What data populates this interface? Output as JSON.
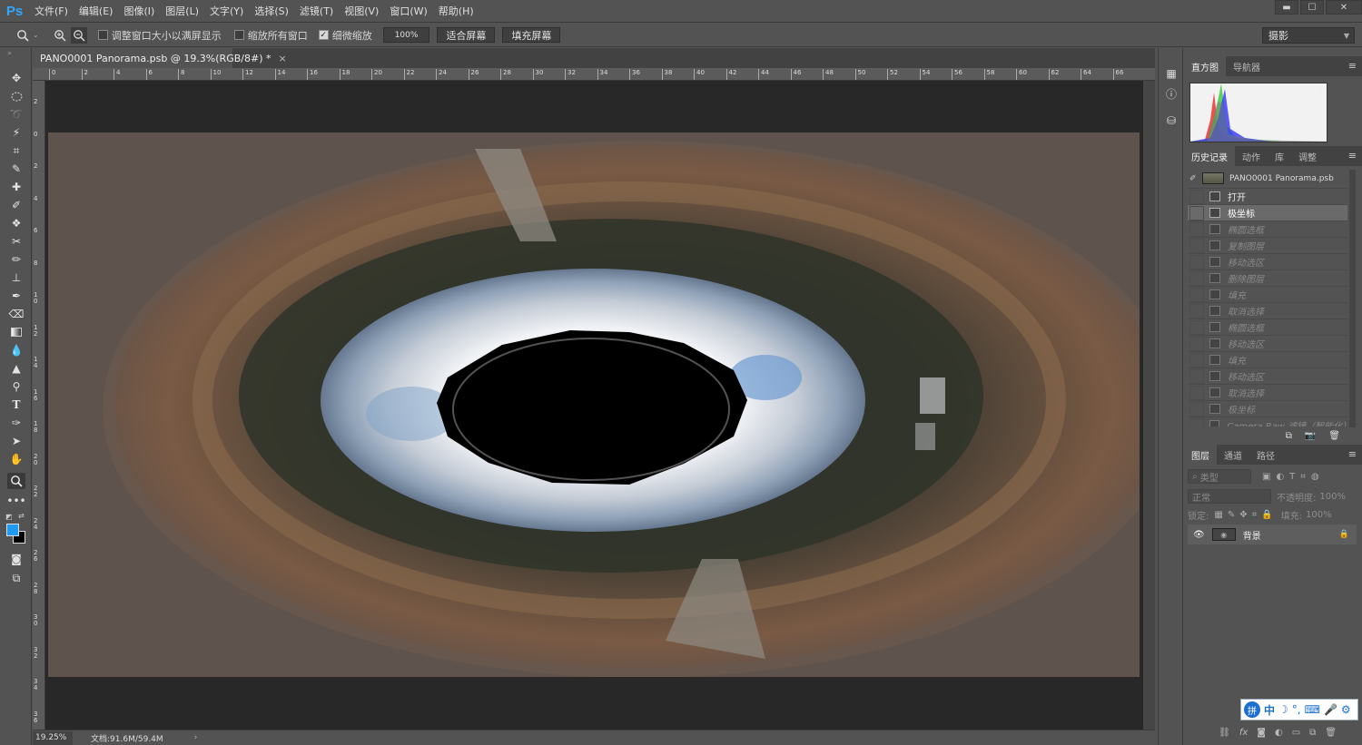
{
  "app": {
    "logo": "Ps"
  },
  "menu": [
    "文件(F)",
    "编辑(E)",
    "图像(I)",
    "图层(L)",
    "文字(Y)",
    "选择(S)",
    "滤镜(T)",
    "视图(V)",
    "窗口(W)",
    "帮助(H)"
  ],
  "window_controls": {
    "minimize": "▬",
    "maximize": "☐",
    "close": "✕"
  },
  "options": {
    "zoom_tool_icon": "zoom-icon",
    "resize_windows_label": "调整窗口大小以满屏显示",
    "resize_windows_checked": false,
    "zoom_all_label": "缩放所有窗口",
    "zoom_all_checked": false,
    "scrubby_label": "细微缩放",
    "scrubby_checked": true,
    "btn_100": "100%",
    "btn_fit": "适合屏幕",
    "btn_fill": "填充屏幕",
    "workspace": "摄影"
  },
  "document": {
    "tab_title": "PANO0001 Panorama.psb @ 19.3%(RGB/8#) *",
    "tab_close": "×",
    "ruler_h_labels": [
      "0",
      "2",
      "4",
      "6",
      "8",
      "10",
      "12",
      "14",
      "16",
      "18",
      "20",
      "22",
      "24",
      "26",
      "28",
      "30",
      "32",
      "34",
      "36",
      "38",
      "40",
      "42",
      "44",
      "46",
      "48",
      "50",
      "52",
      "54",
      "56",
      "58",
      "60",
      "62",
      "64",
      "66"
    ],
    "ruler_v_labels": [
      "2",
      "0",
      "2",
      "4",
      "6",
      "8",
      "1 0",
      "1 2",
      "1 4",
      "1 6",
      "1 8",
      "2 0",
      "2 2",
      "2 4",
      "2 6",
      "2 8",
      "3 0",
      "3 2",
      "3 4",
      "3 6"
    ]
  },
  "status": {
    "zoom": "19.25%",
    "doc_info": "文档:91.6M/59.4M",
    "arrow": "›"
  },
  "panels": {
    "histogram_tabs": [
      "直方图",
      "导航器"
    ],
    "history_tabs": [
      "历史记录",
      "动作",
      "库",
      "调整"
    ],
    "history_snapshot": "PANO0001 Panorama.psb",
    "history_items": [
      {
        "label": "打开",
        "state": "normal"
      },
      {
        "label": "极坐标",
        "state": "selected"
      },
      {
        "label": "椭圆选框",
        "state": "dim"
      },
      {
        "label": "复制图层",
        "state": "dim"
      },
      {
        "label": "移动选区",
        "state": "dim"
      },
      {
        "label": "删除图层",
        "state": "dim"
      },
      {
        "label": "填充",
        "state": "dim"
      },
      {
        "label": "取消选择",
        "state": "dim"
      },
      {
        "label": "椭圆选框",
        "state": "dim"
      },
      {
        "label": "移动选区",
        "state": "dim"
      },
      {
        "label": "填充",
        "state": "dim"
      },
      {
        "label": "移动选区",
        "state": "dim"
      },
      {
        "label": "取消选择",
        "state": "dim"
      },
      {
        "label": "极坐标",
        "state": "dim"
      },
      {
        "label": "Camera Raw 滤镜（智能化）",
        "state": "dim"
      }
    ],
    "layers_tabs": [
      "图层",
      "通道",
      "路径"
    ],
    "layer_filter": "类型",
    "blend_mode": "正常",
    "opacity_label": "不透明度:",
    "opacity_value": "100%",
    "lock_label": "锁定:",
    "fill_label": "填充:",
    "fill_value": "100%",
    "layer_name": "背景"
  },
  "ime": {
    "logo": "拼",
    "mode": "中"
  }
}
